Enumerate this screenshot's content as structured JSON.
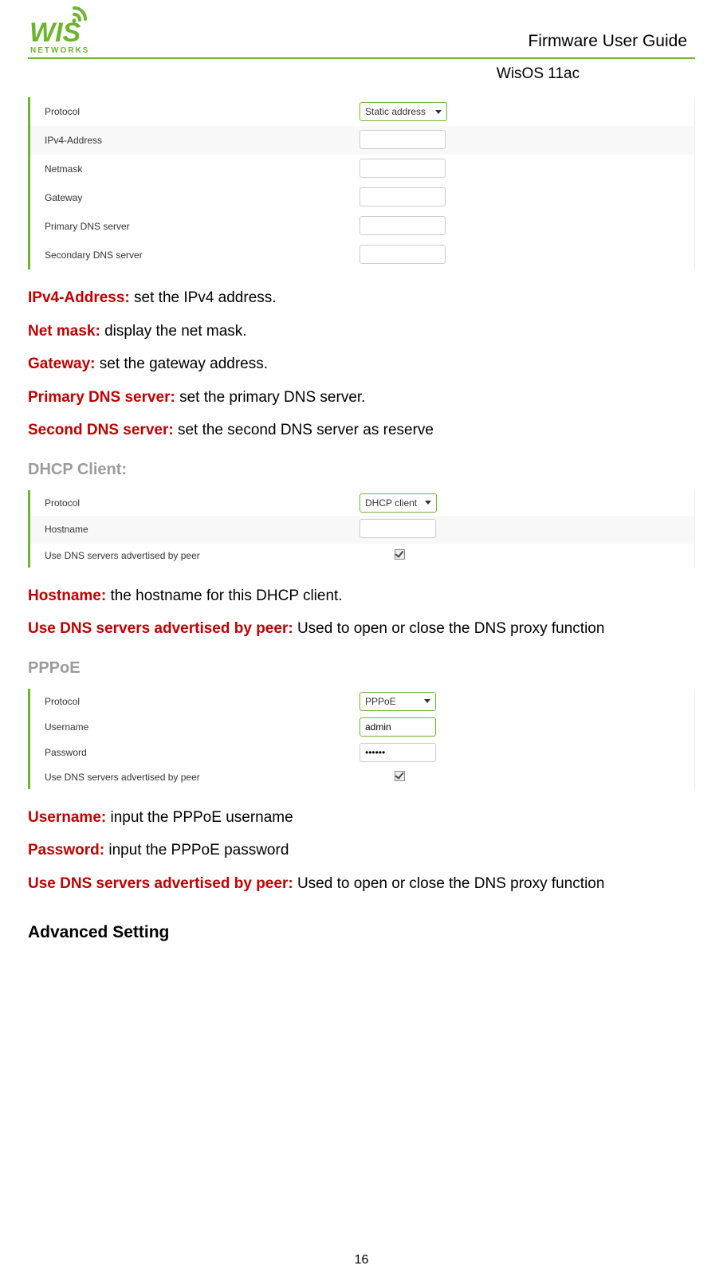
{
  "header": {
    "logo_brand": "WIS",
    "logo_sub": "NETWORKS",
    "title": "Firmware User Guide",
    "subtitle": "WisOS 11ac"
  },
  "page_number": "16",
  "panel_static": {
    "protocol_label": "Protocol",
    "protocol_value": "Static address",
    "ipv4_label": "IPv4-Address",
    "netmask_label": "Netmask",
    "gateway_label": "Gateway",
    "pdns_label": "Primary DNS server",
    "sdns_label": "Secondary DNS server"
  },
  "defs_static": {
    "ipv4_term": "IPv4-Address:",
    "ipv4_def": " set the IPv4 address.",
    "netmask_term": "Net mask:",
    "netmask_def": " display the net mask.",
    "gateway_term": "Gateway:",
    "gateway_def": " set the gateway address.",
    "pdns_term": "Primary DNS server:",
    "pdns_def": " set the primary DNS server.",
    "sdns_term": "Second DNS server:",
    "sdns_def": " set the second DNS server as reserve"
  },
  "section_dhcp": "DHCP Client:",
  "panel_dhcp": {
    "protocol_label": "Protocol",
    "protocol_value": "DHCP client",
    "hostname_label": "Hostname",
    "usedns_label": "Use DNS servers advertised by peer"
  },
  "defs_dhcp": {
    "hostname_term": "Hostname:",
    "hostname_def": " the hostname for this DHCP client.",
    "usedns_term": "Use DNS servers advertised by peer:",
    "usedns_def": " Used to open or close the DNS proxy function"
  },
  "section_pppoe": "PPPoE",
  "panel_pppoe": {
    "protocol_label": "Protocol",
    "protocol_value": "PPPoE",
    "username_label": "Username",
    "username_value": "admin",
    "password_label": "Password",
    "password_value": "••••••",
    "usedns_label": "Use DNS servers advertised by peer"
  },
  "defs_pppoe": {
    "username_term": "Username:",
    "username_def": " input the PPPoE username",
    "password_term": "Password:",
    "password_def": " input the PPPoE password",
    "usedns_term": "Use DNS servers advertised by peer:",
    "usedns_def": " Used to open or close the DNS proxy function"
  },
  "section_advanced": "Advanced Setting"
}
